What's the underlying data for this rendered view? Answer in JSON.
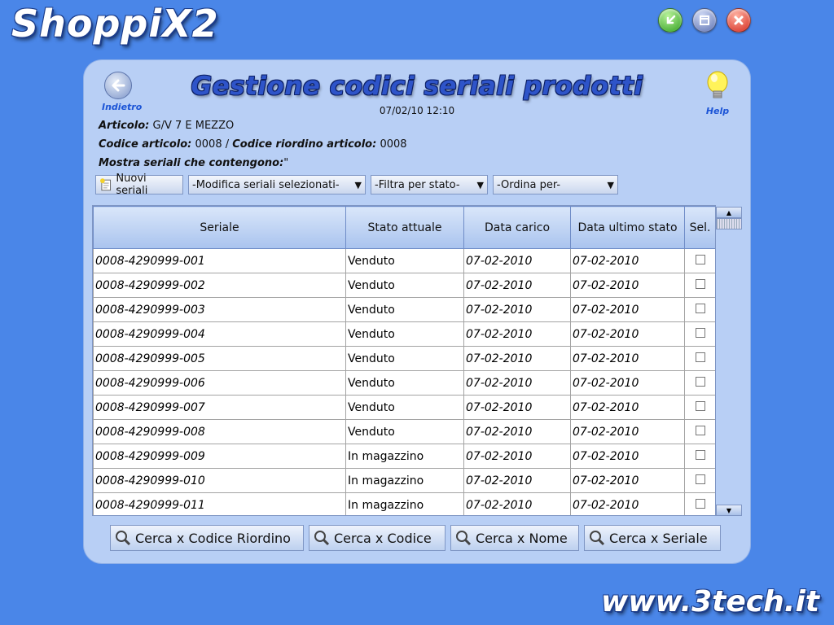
{
  "app": {
    "title": "ShoppiX2",
    "footer": "www.3tech.it"
  },
  "window_controls": {
    "minimize": "minimize",
    "restore": "restore",
    "close": "close"
  },
  "header": {
    "back_label": "Indietro",
    "title": "Gestione codici seriali prodotti",
    "timestamp": "07/02/10 12:10",
    "help_label": "Help"
  },
  "info": {
    "articolo_label": "Articolo:",
    "articolo_value": "G/V 7 E MEZZO",
    "codice_label": "Codice articolo:",
    "codice_value": "0008",
    "sep": " / ",
    "riordino_label": "Codice riordino articolo:",
    "riordino_value": "0008",
    "mostra_label": "Mostra seriali che contengono:",
    "mostra_value": "\""
  },
  "toolbar": {
    "new_label": "Nuovi seriali",
    "modify_select": "-Modifica seriali selezionati-",
    "filter_select": "-Filtra per stato-",
    "sort_select": "-Ordina per-"
  },
  "table": {
    "columns": [
      "Seriale",
      "Stato attuale",
      "Data carico",
      "Data ultimo stato",
      "Sel."
    ],
    "rows": [
      [
        "0008-4290999-001",
        "Venduto",
        "07-02-2010",
        "07-02-2010"
      ],
      [
        "0008-4290999-002",
        "Venduto",
        "07-02-2010",
        "07-02-2010"
      ],
      [
        "0008-4290999-003",
        "Venduto",
        "07-02-2010",
        "07-02-2010"
      ],
      [
        "0008-4290999-004",
        "Venduto",
        "07-02-2010",
        "07-02-2010"
      ],
      [
        "0008-4290999-005",
        "Venduto",
        "07-02-2010",
        "07-02-2010"
      ],
      [
        "0008-4290999-006",
        "Venduto",
        "07-02-2010",
        "07-02-2010"
      ],
      [
        "0008-4290999-007",
        "Venduto",
        "07-02-2010",
        "07-02-2010"
      ],
      [
        "0008-4290999-008",
        "Venduto",
        "07-02-2010",
        "07-02-2010"
      ],
      [
        "0008-4290999-009",
        "In magazzino",
        "07-02-2010",
        "07-02-2010"
      ],
      [
        "0008-4290999-010",
        "In magazzino",
        "07-02-2010",
        "07-02-2010"
      ],
      [
        "0008-4290999-011",
        "In magazzino",
        "07-02-2010",
        "07-02-2010"
      ]
    ]
  },
  "search_buttons": {
    "riordino": "Cerca x Codice Riordino",
    "codice": "Cerca x Codice",
    "nome": "Cerca x Nome",
    "seriale": "Cerca x Seriale"
  },
  "colors": {
    "background": "#4a86e8",
    "panel": "#b8cff5",
    "title": "#2e54c9"
  }
}
